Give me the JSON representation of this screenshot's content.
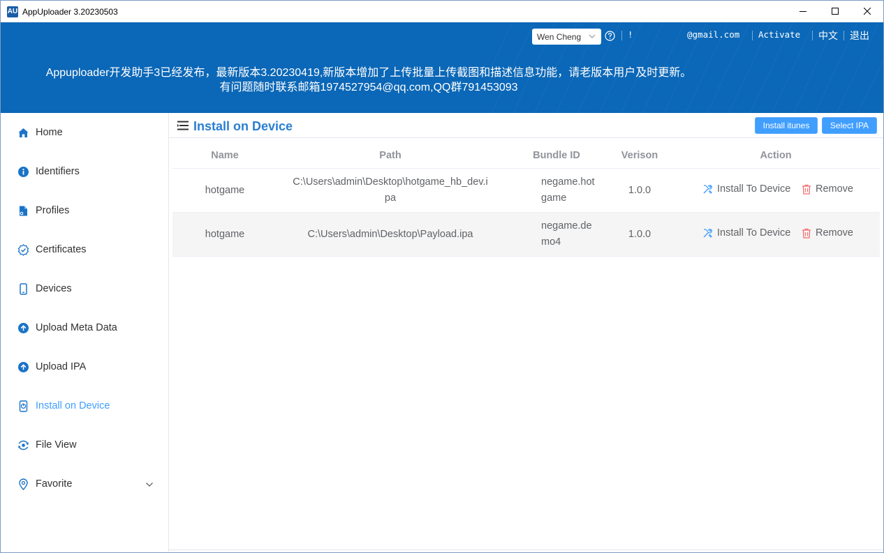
{
  "window": {
    "logo": "AU",
    "title": "AppUploader 3.20230503",
    "controls": [
      "minimize-icon",
      "maximize-icon",
      "close-icon"
    ]
  },
  "topbar": {
    "user_name": "Wen Cheng",
    "link_truncated": "!",
    "email": "@gmail.com",
    "activate": "Activate",
    "language": "中文",
    "logout": "退出"
  },
  "notice": {
    "line1": "Appuploader开发助手3已经发布，最新版本3.20230419,新版本增加了上传批量上传截图和描述信息功能，请老版本用户及时更新。",
    "line2": "有问题随时联系邮箱1974527954@qq.com,QQ群791453093"
  },
  "sidebar": {
    "items": [
      {
        "label": "Home",
        "icon": "home-icon"
      },
      {
        "label": "Identifiers",
        "icon": "info-icon"
      },
      {
        "label": "Profiles",
        "icon": "document-icon"
      },
      {
        "label": "Certificates",
        "icon": "certificate-check-icon"
      },
      {
        "label": "Devices",
        "icon": "phone-icon"
      },
      {
        "label": "Upload Meta Data",
        "icon": "upload-circle-icon"
      },
      {
        "label": "Upload IPA",
        "icon": "upload-circle-icon"
      },
      {
        "label": "Install on Device",
        "icon": "install-phone-icon",
        "active": true
      },
      {
        "label": "File View",
        "icon": "eye-refresh-icon"
      },
      {
        "label": "Favorite",
        "icon": "location-pin-icon",
        "expandable": true
      }
    ]
  },
  "page": {
    "title": "Install on Device",
    "buttons": {
      "install_itunes": "Install itunes",
      "select_ipa": "Select IPA"
    }
  },
  "table": {
    "columns": {
      "name": "Name",
      "path": "Path",
      "bundle_id": "Bundle ID",
      "version": "Verison",
      "action": "Action"
    },
    "rows": [
      {
        "name": "hotgame",
        "path_line1": "C:\\Users\\admin\\Desktop\\hotgame_hb_dev.i",
        "path_line2": "pa",
        "bundle_line1": "negame.hot",
        "bundle_line2": "game",
        "version": "1.0.0",
        "install": "Install To Device",
        "remove": "Remove"
      },
      {
        "name": "hotgame",
        "path_line1": "C:\\Users\\admin\\Desktop\\Payload.ipa",
        "path_line2": "",
        "bundle_line1": "negame.de",
        "bundle_line2": "mo4",
        "version": "1.0.0",
        "install": "Install To Device",
        "remove": "Remove"
      }
    ]
  },
  "colors": {
    "banner": "#0b67b7",
    "accent": "#409eff",
    "title": "#2a7fd1",
    "remove": "#f56c6c"
  }
}
